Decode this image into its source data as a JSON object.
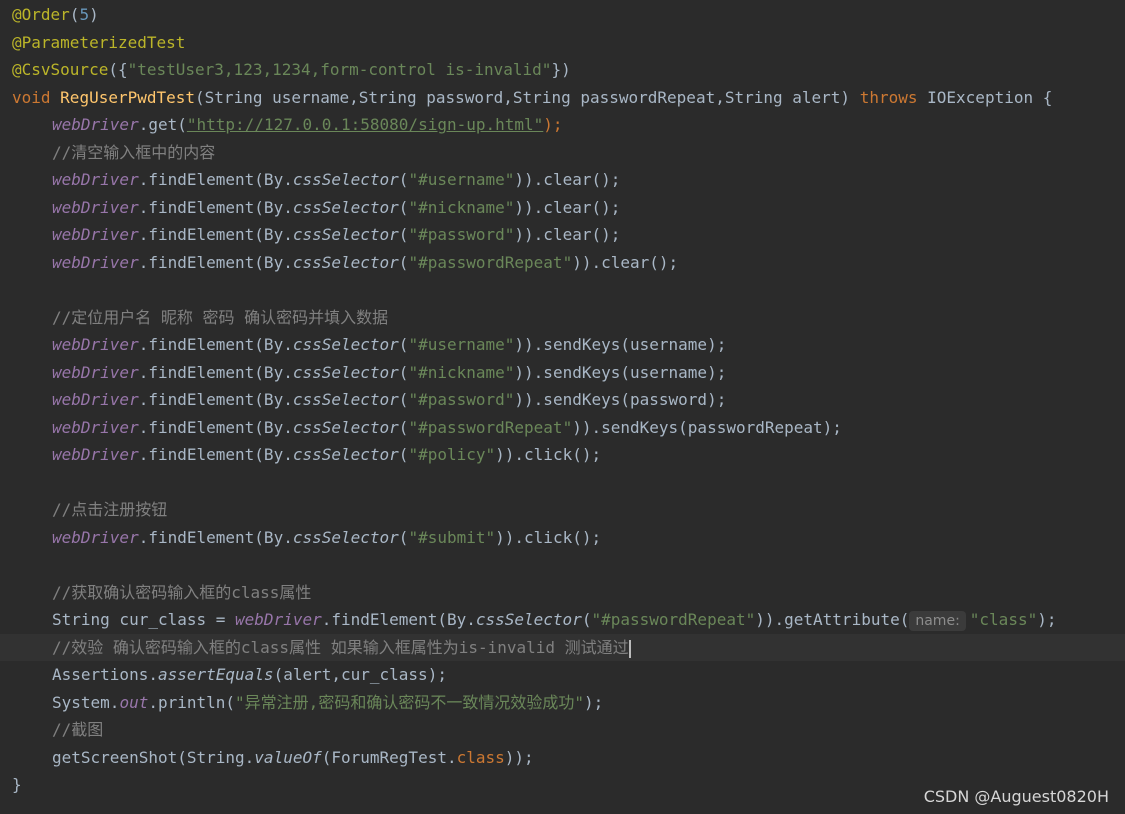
{
  "code": {
    "l1": {
      "ann": "@Order",
      "paren_open": "(",
      "num": "5",
      "paren_close": ")"
    },
    "l2": {
      "ann": "@ParameterizedTest"
    },
    "l3": {
      "ann": "@CsvSource",
      "open": "({",
      "str": "\"testUser3,123,1234,form-control is-invalid\"",
      "close": "})"
    },
    "l4": {
      "kw_void": "void",
      "name": "RegUserPwdTest",
      "params": "(String username,String password,String passwordRepeat,String alert)",
      "kw_throws": "throws",
      "exception": "IOException {"
    },
    "l5": {
      "obj": "webDriver",
      "call": ".get(",
      "url": "\"http://127.0.0.1:58080/sign-up.html\"",
      "end": ");"
    },
    "l6": {
      "comment": "//清空输入框中的内容"
    },
    "l7": {
      "selector": "\"#username\"",
      "tail": ")).clear();"
    },
    "l8": {
      "selector": "\"#nickname\"",
      "tail": ")).clear();"
    },
    "l9": {
      "selector": "\"#password\"",
      "tail": ")).clear();"
    },
    "l10": {
      "selector": "\"#passwordRepeat\"",
      "tail": ")).clear();"
    },
    "l12": {
      "comment": "//定位用户名 昵称 密码 确认密码并填入数据"
    },
    "l13": {
      "selector": "\"#username\"",
      "tail": ")).sendKeys(username);"
    },
    "l14": {
      "selector": "\"#nickname\"",
      "tail": ")).sendKeys(username);"
    },
    "l15": {
      "selector": "\"#password\"",
      "tail": ")).sendKeys(password);"
    },
    "l16": {
      "selector": "\"#passwordRepeat\"",
      "tail": ")).sendKeys(passwordRepeat);"
    },
    "l17": {
      "selector": "\"#policy\"",
      "tail": ")).click();"
    },
    "l19": {
      "comment": "//点击注册按钮"
    },
    "l20": {
      "selector": "\"#submit\"",
      "tail": ")).click();"
    },
    "l22": {
      "comment": "//获取确认密码输入框的class属性"
    },
    "l23": {
      "head": "String cur_class = ",
      "selector": "\"#passwordRepeat\"",
      "mid": ")).getAttribute(",
      "hint": "name:",
      "arg": "\"class\"",
      "end": ");"
    },
    "l24": {
      "comment": "//效验 确认密码输入框的class属性 如果输入框属性为is-invalid 测试通过"
    },
    "l25": {
      "obj": "Assertions.",
      "method": "assertEquals",
      "args": "(alert,cur_class);"
    },
    "l26": {
      "obj": "System.",
      "field": "out",
      "call": ".println(",
      "str": "\"异常注册,密码和确认密码不一致情况效验成功\"",
      "end": ");"
    },
    "l27": {
      "comment": "//截图"
    },
    "l28": {
      "head": "getScreenShot(String.",
      "method": "valueOf",
      "open": "(ForumRegTest.",
      "kw": "class",
      "end": "));"
    },
    "l29": {
      "brace": "}"
    },
    "common": {
      "webdriver": "webDriver",
      "find": ".findElement(By.",
      "css": "cssSelector",
      "paren": "("
    }
  },
  "watermark": "CSDN @Auguest0820H",
  "theme": {
    "background": "#2b2b2b",
    "current_line": "#323232"
  }
}
